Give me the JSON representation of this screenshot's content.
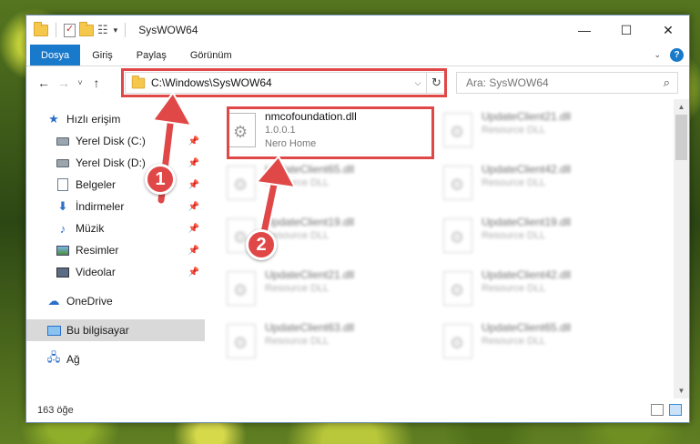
{
  "window": {
    "title": "SysWOW64",
    "controls": {
      "minimize": "—",
      "maximize": "☐",
      "close": "✕"
    }
  },
  "ribbon": {
    "tabs": [
      "Dosya",
      "Giriş",
      "Paylaş",
      "Görünüm"
    ]
  },
  "navigation": {
    "back": "←",
    "forward": "→",
    "recent": "˅",
    "up": "↑",
    "address": "C:\\Windows\\SysWOW64",
    "search_placeholder": "Ara: SysWOW64"
  },
  "sidebar": {
    "quick_access": "Hızlı erişim",
    "items": [
      {
        "label": "Yerel Disk (C:)",
        "icon": "disk-icon"
      },
      {
        "label": "Yerel Disk (D:)",
        "icon": "disk-icon"
      },
      {
        "label": "Belgeler",
        "icon": "documents-icon"
      },
      {
        "label": "İndirmeler",
        "icon": "downloads-icon"
      },
      {
        "label": "Müzik",
        "icon": "music-icon"
      },
      {
        "label": "Resimler",
        "icon": "pictures-icon"
      },
      {
        "label": "Videolar",
        "icon": "videos-icon"
      }
    ],
    "onedrive": "OneDrive",
    "this_pc": "Bu bilgisayar",
    "network": "Ağ"
  },
  "files": [
    {
      "name": "nmcofoundation.dll",
      "line2": "1.0.0.1",
      "line3": "Nero Home",
      "blurred": false
    },
    {
      "name": "UpdateClient21.dll",
      "line2": "Resource DLL",
      "blurred": true
    },
    {
      "name": "UpdateClient65.dll",
      "line2": "Resource DLL",
      "blurred": true
    },
    {
      "name": "UpdateClient42.dll",
      "line2": "Resource DLL",
      "blurred": true
    },
    {
      "name": "UpdateClient19.dll",
      "line2": "Resource DLL",
      "blurred": true
    },
    {
      "name": "UpdateClient19.dll",
      "line2": "Resource DLL",
      "blurred": true
    },
    {
      "name": "UpdateClient21.dll",
      "line2": "Resource DLL",
      "blurred": true
    },
    {
      "name": "UpdateClient42.dll",
      "line2": "Resource DLL",
      "blurred": true
    },
    {
      "name": "UpdateClient63.dll",
      "line2": "Resource DLL",
      "blurred": true
    },
    {
      "name": "UpdateClient65.dll",
      "line2": "Resource DLL",
      "blurred": true
    }
  ],
  "status": {
    "count": "163 öğe"
  },
  "annotations": {
    "step1": "1",
    "step2": "2",
    "color": "#e04848"
  }
}
